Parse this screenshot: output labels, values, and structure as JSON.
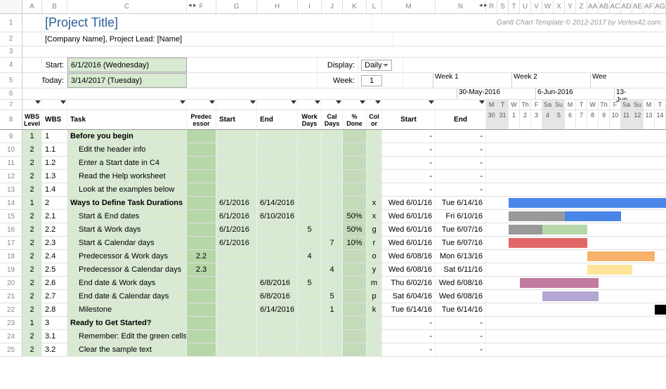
{
  "footer": "Gantt Chart Template © 2012-2017 by Vertex42.com:",
  "title": "[Project Title]",
  "subtitle": "[Company Name], Project Lead: [Name]",
  "labels": {
    "start": "Start:",
    "today": "Today:",
    "display": "Display:",
    "week": "Week:"
  },
  "inputs": {
    "start": "6/1/2016 (Wednesday)",
    "today": "3/14/2017 (Tuesday)",
    "display": "Daily",
    "week": "1"
  },
  "col_letters": [
    "A",
    "B",
    "C",
    "F",
    "G",
    "H",
    "I",
    "J",
    "K",
    "L",
    "M",
    "N",
    "R",
    "S",
    "T",
    "U",
    "V",
    "W",
    "X",
    "Y",
    "Z",
    "AA",
    "AB",
    "AC",
    "AD",
    "AE",
    "AF",
    "AG"
  ],
  "col_widths": [
    "wA",
    "wB",
    "wC",
    "wF",
    "wG",
    "wH",
    "wI",
    "wJ",
    "wK",
    "wL",
    "wM",
    "wN",
    "wDay",
    "wDay",
    "wDay",
    "wDay",
    "wDay",
    "wDay",
    "wDay",
    "wDay",
    "wDay",
    "wDay",
    "wDay",
    "wDay",
    "wDay",
    "wDay",
    "wDay",
    "wDay"
  ],
  "headers8": {
    "wbs_level": "WBS Level",
    "wbs": "WBS",
    "task": "Task",
    "pred": "Predec essor",
    "start": "Start",
    "end": "End",
    "work": "Work Days",
    "cal": "Cal Days",
    "pct": "% Done",
    "color": "Col or",
    "cstart": "Start",
    "cend": "End"
  },
  "week_headers": [
    {
      "label": "Week 1",
      "date": "30-May-2016",
      "days": [
        "M",
        "T",
        "W",
        "Th",
        "F",
        "Sa",
        "Su"
      ],
      "nums": [
        "30",
        "31",
        "1",
        "2",
        "3",
        "4",
        "5"
      ],
      "grey": [
        0,
        1,
        5,
        6
      ]
    },
    {
      "label": "Week 2",
      "date": "6-Jun-2016",
      "days": [
        "M",
        "T",
        "W",
        "Th",
        "F",
        "Sa",
        "Su"
      ],
      "nums": [
        "6",
        "7",
        "8",
        "9",
        "10",
        "11",
        "12"
      ],
      "grey": [
        5,
        6
      ]
    },
    {
      "label": "Wee",
      "date": "13-Jun",
      "days": [
        "M",
        "T"
      ],
      "nums": [
        "13",
        "14"
      ],
      "grey": []
    }
  ],
  "rows": [
    {
      "n": 9,
      "lvl": "1",
      "wbs": "1",
      "task": "Before you begin",
      "bold": true,
      "g": 1,
      "cstart": "-",
      "cend": "-"
    },
    {
      "n": 10,
      "lvl": "2",
      "wbs": "1.1",
      "task": "Edit the header info",
      "indent": 1,
      "g": 1,
      "cstart": "-",
      "cend": "-"
    },
    {
      "n": 11,
      "lvl": "2",
      "wbs": "1.2",
      "task": "Enter a Start date in C4",
      "indent": 1,
      "g": 1,
      "cstart": "-",
      "cend": "-"
    },
    {
      "n": 12,
      "lvl": "2",
      "wbs": "1.3",
      "task": "Read the Help worksheet",
      "indent": 1,
      "g": 1,
      "cstart": "-",
      "cend": "-"
    },
    {
      "n": 13,
      "lvl": "2",
      "wbs": "1.4",
      "task": "Look at the examples below",
      "indent": 1,
      "g": 1,
      "cstart": "-",
      "cend": "-"
    },
    {
      "n": 14,
      "lvl": "1",
      "wbs": "2",
      "task": "Ways to Define Task Durations",
      "bold": true,
      "g": 1,
      "start": "6/1/2016",
      "end": "6/14/2016",
      "color": "x",
      "cstart": "Wed 6/01/16",
      "cend": "Tue 6/14/16",
      "bar": {
        "from": 2,
        "len": 14,
        "c": "#4a86e8"
      }
    },
    {
      "n": 15,
      "lvl": "2",
      "wbs": "2.1",
      "task": "Start & End dates",
      "indent": 1,
      "g": 1,
      "start": "6/1/2016",
      "end": "6/10/2016",
      "pct": "50%",
      "color": "x",
      "cstart": "Wed 6/01/16",
      "cend": "Fri 6/10/16",
      "bar": {
        "from": 2,
        "len": 10,
        "c": "#4a86e8"
      },
      "bar2": {
        "from": 2,
        "len": 5,
        "c": "#999"
      }
    },
    {
      "n": 16,
      "lvl": "2",
      "wbs": "2.2",
      "task": "Start & Work days",
      "indent": 1,
      "g": 1,
      "start": "6/1/2016",
      "work": "5",
      "pct": "50%",
      "color": "g",
      "cstart": "Wed 6/01/16",
      "cend": "Tue 6/07/16",
      "bar": {
        "from": 2,
        "len": 3,
        "c": "#999"
      },
      "bar2": {
        "from": 5,
        "len": 4,
        "c": "#b6d7a8"
      }
    },
    {
      "n": 17,
      "lvl": "2",
      "wbs": "2.3",
      "task": "Start & Calendar days",
      "indent": 1,
      "g": 1,
      "start": "6/1/2016",
      "cal": "7",
      "pct": "10%",
      "color": "r",
      "cstart": "Wed 6/01/16",
      "cend": "Tue 6/07/16",
      "bar": {
        "from": 2,
        "len": 7,
        "c": "#e06666"
      }
    },
    {
      "n": 18,
      "lvl": "2",
      "wbs": "2.4",
      "task": "Predecessor & Work days",
      "indent": 1,
      "g": 1,
      "pred": "2.2",
      "work": "4",
      "color": "o",
      "cstart": "Wed 6/08/16",
      "cend": "Mon 6/13/16",
      "bar": {
        "from": 9,
        "len": 6,
        "c": "#f6b26b"
      }
    },
    {
      "n": 19,
      "lvl": "2",
      "wbs": "2.5",
      "task": "Predecessor & Calendar days",
      "indent": 1,
      "g": 1,
      "pred": "2.3",
      "cal": "4",
      "color": "y",
      "cstart": "Wed 6/08/16",
      "cend": "Sat 6/11/16",
      "bar": {
        "from": 9,
        "len": 4,
        "c": "#ffe599"
      }
    },
    {
      "n": 20,
      "lvl": "2",
      "wbs": "2.6",
      "task": "End date & Work days",
      "indent": 1,
      "g": 1,
      "end": "6/8/2016",
      "work": "5",
      "color": "m",
      "cstart": "Thu 6/02/16",
      "cend": "Wed 6/08/16",
      "bar": {
        "from": 3,
        "len": 7,
        "c": "#c27ba0"
      }
    },
    {
      "n": 21,
      "lvl": "2",
      "wbs": "2.7",
      "task": "End date & Calendar days",
      "indent": 1,
      "g": 1,
      "end": "6/8/2016",
      "cal": "5",
      "color": "p",
      "cstart": "Sat 6/04/16",
      "cend": "Wed 6/08/16",
      "bar": {
        "from": 5,
        "len": 5,
        "c": "#b4a7d6"
      }
    },
    {
      "n": 22,
      "lvl": "2",
      "wbs": "2.8",
      "task": "Milestone",
      "indent": 1,
      "g": 1,
      "end": "6/14/2016",
      "cal": "1",
      "color": "k",
      "cstart": "Tue 6/14/16",
      "cend": "Tue 6/14/16",
      "bar": {
        "from": 15,
        "len": 1,
        "c": "#000"
      }
    },
    {
      "n": 23,
      "lvl": "1",
      "wbs": "3",
      "task": "Ready to Get Started?",
      "bold": true,
      "g": 1,
      "cstart": "-",
      "cend": "-"
    },
    {
      "n": 24,
      "lvl": "2",
      "wbs": "3.1",
      "task": "Remember: Edit the green cells",
      "indent": 1,
      "g": 1,
      "cstart": "-",
      "cend": "-"
    },
    {
      "n": 25,
      "lvl": "2",
      "wbs": "3.2",
      "task": "Clear the sample text",
      "indent": 1,
      "g": 1,
      "cstart": "-",
      "cend": "-"
    }
  ]
}
